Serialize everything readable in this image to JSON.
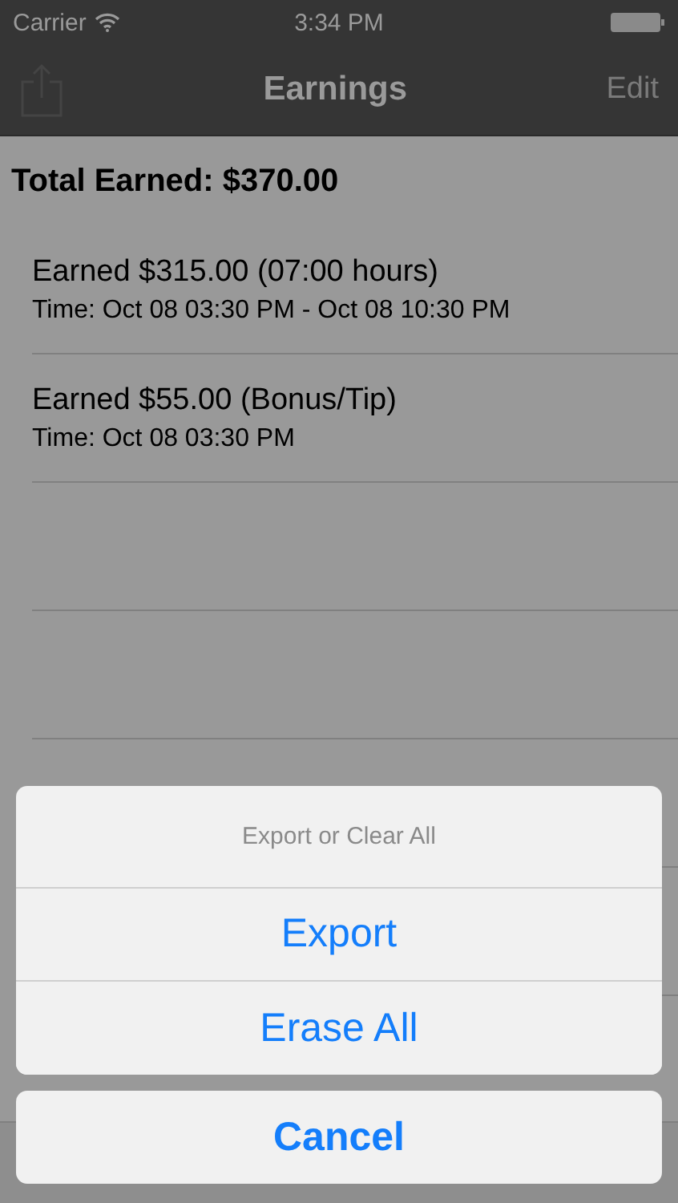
{
  "status_bar": {
    "carrier": "Carrier",
    "time": "3:34 PM"
  },
  "nav_bar": {
    "title": "Earnings",
    "right_button": "Edit"
  },
  "total": "Total Earned: $370.00",
  "entries": [
    {
      "title": "Earned $315.00 (07:00 hours)",
      "detail": "Time: Oct 08 03:30 PM - Oct 08 10:30 PM"
    },
    {
      "title": "Earned $55.00 (Bonus/Tip)",
      "detail": "Time: Oct 08 03:30 PM"
    }
  ],
  "action_sheet": {
    "title": "Export or Clear All",
    "actions": [
      "Export",
      "Erase All"
    ],
    "cancel": "Cancel"
  }
}
